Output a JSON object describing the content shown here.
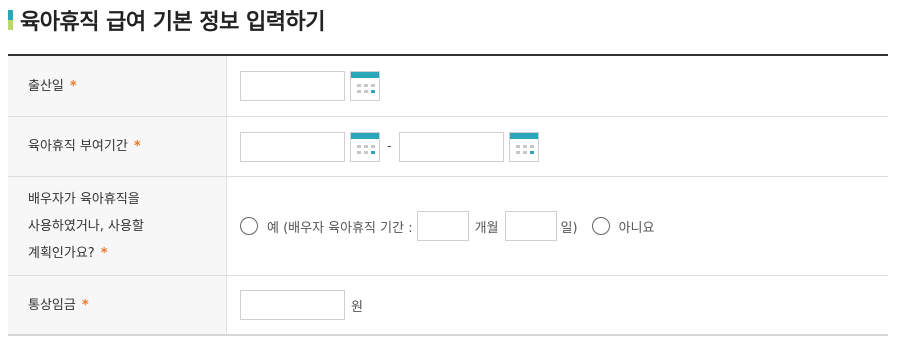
{
  "page": {
    "title": "육아휴직 급여 기본 정보 입력하기"
  },
  "form": {
    "required_mark": "*",
    "birth_date": {
      "label": "출산일"
    },
    "leave_period": {
      "label": "육아휴직 부여기간",
      "separator": "-"
    },
    "spouse_leave": {
      "label_lines": [
        "배우자가 육아휴직을",
        "사용하였거나, 사용할",
        "계획인가요?"
      ],
      "option_yes": "예 (배우자 육아휴직 기간 :",
      "months_unit": "개월",
      "days_unit": "일)",
      "option_no": "아니요"
    },
    "wage": {
      "label": "통상임금",
      "unit": "원"
    }
  },
  "colors": {
    "accent": "#2aa7b8",
    "accent2": "#b9d86b",
    "required": "#e8792c"
  }
}
